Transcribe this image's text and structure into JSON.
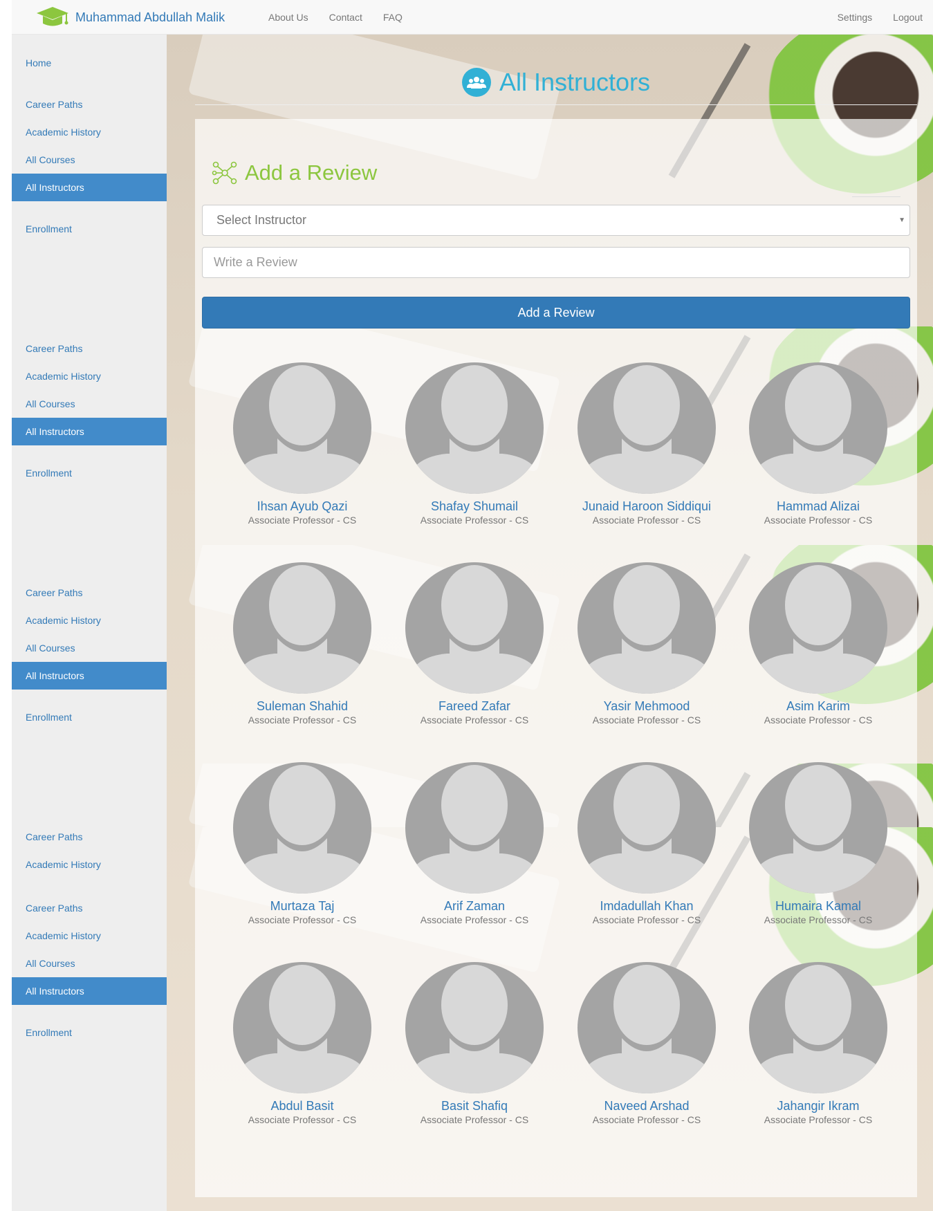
{
  "navbar": {
    "brand": "Muhammad Abdullah Malik",
    "brand_icon": "graduation-cap-icon",
    "left_links": [
      "About Us",
      "Contact",
      "FAQ"
    ],
    "right_links": [
      "Settings",
      "Logout"
    ]
  },
  "sidebar": {
    "groups": [
      [
        "Home",
        "Career Paths",
        "Academic History",
        "All Courses",
        "All Instructors",
        "Enrollment"
      ],
      [
        "Career Paths",
        "Academic History",
        "All Courses",
        "All Instructors",
        "Enrollment"
      ],
      [
        "Career Paths",
        "Academic History",
        "All Courses",
        "All Instructors",
        "Enrollment"
      ],
      [
        "Career Paths",
        "Academic History"
      ],
      [
        "Career Paths",
        "Academic History",
        "All Courses",
        "All Instructors",
        "Enrollment"
      ]
    ],
    "active_label": "All Instructors",
    "active_color": "#428bca"
  },
  "page": {
    "title": "All Instructors",
    "title_icon": "users-icon",
    "accent_color": "#31b0d5"
  },
  "review": {
    "title": "Add a Review",
    "title_icon": "molecule-icon",
    "select_placeholder": "Select Instructor",
    "input_placeholder": "Write a Review",
    "button_label": "Add a Review",
    "button_color": "#337ab7"
  },
  "instructors": [
    {
      "name": "Ihsan Ayub Qazi",
      "title": "Associate Professor - CS"
    },
    {
      "name": "Shafay Shumail",
      "title": "Associate Professor - CS"
    },
    {
      "name": "Junaid Haroon Siddiqui",
      "title": "Associate Professor - CS"
    },
    {
      "name": "Hammad Alizai",
      "title": "Associate Professor - CS"
    },
    {
      "name": "Suleman Shahid",
      "title": "Associate Professor - CS"
    },
    {
      "name": "Fareed Zafar",
      "title": "Associate Professor - CS"
    },
    {
      "name": "Yasir Mehmood",
      "title": "Associate Professor - CS"
    },
    {
      "name": "Asim Karim",
      "title": "Associate Professor - CS"
    },
    {
      "name": "Murtaza Taj",
      "title": "Associate Professor - CS"
    },
    {
      "name": "Arif Zaman",
      "title": "Associate Professor - CS"
    },
    {
      "name": "Imdadullah Khan",
      "title": "Associate Professor - CS"
    },
    {
      "name": "Humaira Kamal",
      "title": "Associate Professor - CS"
    },
    {
      "name": "Abdul Basit",
      "title": "Associate Professor - CS"
    },
    {
      "name": "Basit Shafiq",
      "title": "Associate Professor - CS"
    },
    {
      "name": "Naveed Arshad",
      "title": "Associate Professor - CS"
    },
    {
      "name": "Jahangir Ikram",
      "title": "Associate Professor - CS"
    }
  ]
}
